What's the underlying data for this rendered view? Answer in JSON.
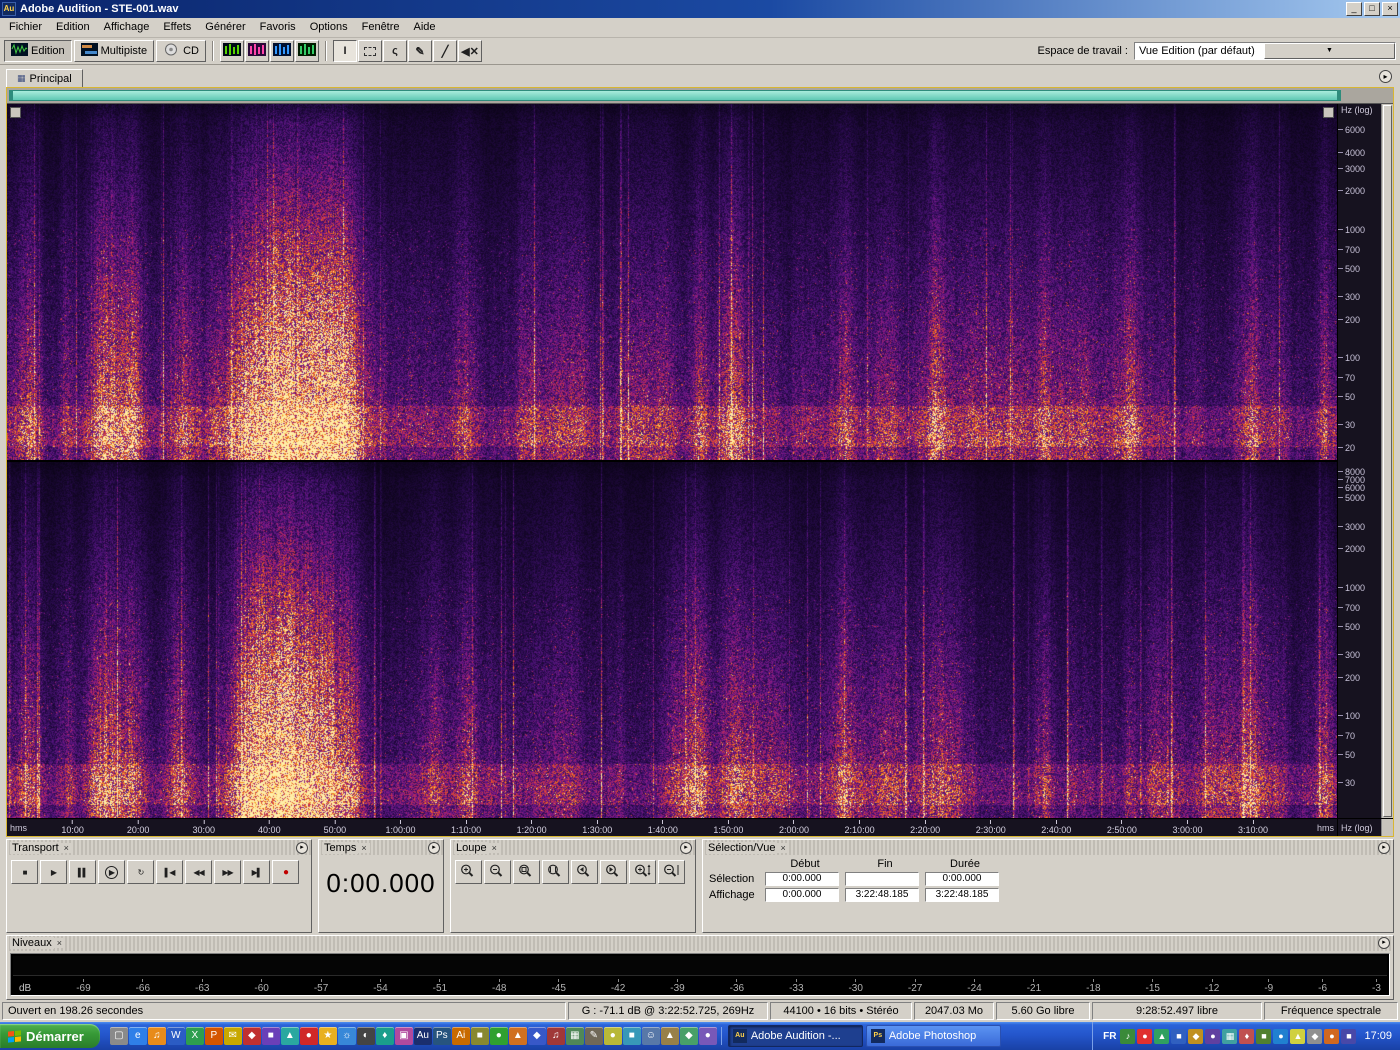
{
  "window": {
    "title": "Adobe Audition - STE-001.wav",
    "icon_text": "Au"
  },
  "icons": {
    "minimize": "_",
    "maximize": "□",
    "close": "×",
    "combo_arrow": "▼",
    "close_panel": "×",
    "panel_menu": "▸",
    "tab_icon": "▦"
  },
  "menubar": {
    "items": [
      "Fichier",
      "Edition",
      "Affichage",
      "Effets",
      "Générer",
      "Favoris",
      "Options",
      "Fenêtre",
      "Aide"
    ]
  },
  "toolbar": {
    "modes": [
      {
        "label": "Edition",
        "active": true,
        "icon": "waveform"
      },
      {
        "label": "Multipiste",
        "active": false,
        "icon": "multitrack"
      },
      {
        "label": "CD",
        "active": false,
        "icon": "cd"
      }
    ],
    "view_buttons": [
      {
        "name": "waveform-view-icon",
        "bg": "#000814",
        "fg": "#55d400"
      },
      {
        "name": "spectral-view-icon",
        "bg": "#2a0838",
        "fg": "#ff44aa"
      },
      {
        "name": "spectral-pan-view-icon",
        "bg": "#001030",
        "fg": "#3399ff"
      },
      {
        "name": "spectral-phase-view-icon",
        "bg": "#001c00",
        "fg": "#33cc66"
      }
    ],
    "tools": [
      {
        "name": "time-selection-tool",
        "glyph": "I",
        "active": true
      },
      {
        "name": "marquee-selection-tool",
        "glyph": "",
        "active": false
      },
      {
        "name": "lasso-selection-tool",
        "glyph": "ς",
        "active": false
      },
      {
        "name": "effects-paintbrush-tool",
        "glyph": "✎",
        "active": false
      },
      {
        "name": "pencil-tool",
        "glyph": "╱",
        "active": false
      },
      {
        "name": "scrub-tool",
        "glyph": "◀✕",
        "active": false
      }
    ],
    "workspace_label": "Espace de travail :",
    "workspace_value": "Vue Edition (par défaut)"
  },
  "main_panel": {
    "tab_label": "Principal",
    "hz_log_label": "Hz (log)",
    "hms_label": "hms",
    "freq_ticks_top": [
      "6000",
      "4000",
      "3000",
      "2000",
      "1000",
      "700",
      "500",
      "300",
      "200",
      "100",
      "70",
      "50",
      "30",
      "20"
    ],
    "freq_ticks_bottom": [
      "8000",
      "7000",
      "6000",
      "5000",
      "3000",
      "2000",
      "1000",
      "700",
      "500",
      "300",
      "200",
      "100",
      "70",
      "50",
      "30"
    ],
    "timeline_labels": [
      "10:00",
      "20:00",
      "30:00",
      "40:00",
      "50:00",
      "1:00:00",
      "1:10:00",
      "1:20:00",
      "1:30:00",
      "1:40:00",
      "1:50:00",
      "2:00:00",
      "2:10:00",
      "2:20:00",
      "2:30:00",
      "2:40:00",
      "2:50:00",
      "3:00:00",
      "3:10:00"
    ],
    "duration_min": 202.8,
    "colors": {
      "overview_bar": "#6fd0c0",
      "focus_border": "#d8b632"
    }
  },
  "transport": {
    "title": "Transport",
    "buttons": [
      {
        "name": "stop-button",
        "glyph": "■"
      },
      {
        "name": "play-button",
        "glyph": "▶"
      },
      {
        "name": "pause-button",
        "glyph": "▌▌"
      },
      {
        "name": "play-from-cursor-button",
        "glyph": "▶",
        "circle": true
      },
      {
        "name": "play-looped-button",
        "glyph": "↻"
      },
      {
        "name": "go-to-beginning-button",
        "glyph": "▌◀"
      },
      {
        "name": "rewind-button",
        "glyph": "◀◀"
      },
      {
        "name": "fast-forward-button",
        "glyph": "▶▶"
      },
      {
        "name": "go-to-end-button",
        "glyph": "▶▌"
      },
      {
        "name": "record-button",
        "glyph": "●",
        "red": true
      }
    ]
  },
  "temps": {
    "title": "Temps",
    "value": "0:00.000"
  },
  "loupe": {
    "title": "Loupe",
    "buttons": [
      {
        "name": "zoom-in-horizontal-button",
        "deco": "plus"
      },
      {
        "name": "zoom-out-horizontal-button",
        "deco": "minus"
      },
      {
        "name": "zoom-full-button",
        "deco": "full"
      },
      {
        "name": "zoom-to-selection-button",
        "deco": "sel"
      },
      {
        "name": "zoom-left-edge-selection-button",
        "deco": "left"
      },
      {
        "name": "zoom-right-edge-selection-button",
        "deco": "right"
      },
      {
        "name": "zoom-in-vertical-button",
        "deco": "vplus"
      },
      {
        "name": "zoom-out-vertical-button",
        "deco": "vminus"
      }
    ]
  },
  "selection_vue": {
    "title": "Sélection/Vue",
    "columns": [
      "Début",
      "Fin",
      "Durée"
    ],
    "rows": [
      {
        "label": "Sélection",
        "values": [
          "0:00.000",
          "",
          "0:00.000"
        ]
      },
      {
        "label": "Affichage",
        "values": [
          "0:00.000",
          "3:22:48.185",
          "3:22:48.185"
        ]
      }
    ]
  },
  "niveaux": {
    "title": "Niveaux",
    "db_label": "dB",
    "scale": [
      "-69",
      "-66",
      "-63",
      "-60",
      "-57",
      "-54",
      "-51",
      "-48",
      "-45",
      "-42",
      "-39",
      "-36",
      "-33",
      "-30",
      "-27",
      "-24",
      "-21",
      "-18",
      "-15",
      "-12",
      "-9",
      "-6",
      "-3"
    ]
  },
  "statusbar": {
    "sections": [
      "Ouvert en 198.26 secondes",
      "G : -71.1 dB @ 3:22:52.725, 269Hz",
      "44100 • 16 bits • Stéréo",
      "2047.03 Mo",
      "5.60 Go libre",
      "9:28:52.497 libre",
      "Fréquence spectrale"
    ]
  },
  "taskbar": {
    "start_label": "Démarrer",
    "quicklaunch": [
      {
        "g": "▢",
        "c": "#8a8a8a"
      },
      {
        "g": "e",
        "c": "#2f7fe8"
      },
      {
        "g": "♫",
        "c": "#e88b1a"
      },
      {
        "g": "W",
        "c": "#2b5cc4"
      },
      {
        "g": "X",
        "c": "#2e9e4f"
      },
      {
        "g": "P",
        "c": "#d45500"
      },
      {
        "g": "✉",
        "c": "#c8a800"
      },
      {
        "g": "◆",
        "c": "#c03030"
      },
      {
        "g": "■",
        "c": "#6a3fb8"
      },
      {
        "g": "▲",
        "c": "#2aa8a0"
      },
      {
        "g": "●",
        "c": "#d02828"
      },
      {
        "g": "★",
        "c": "#e8b020"
      },
      {
        "g": "☼",
        "c": "#3888d8"
      },
      {
        "g": "◐",
        "c": "#444444"
      },
      {
        "g": "♦",
        "c": "#1a9e8c"
      },
      {
        "g": "▣",
        "c": "#b04a9e"
      },
      {
        "g": "Au",
        "c": "#1a2e6e"
      },
      {
        "g": "Ps",
        "c": "#27547e"
      },
      {
        "g": "Ai",
        "c": "#c86a00"
      },
      {
        "g": "■",
        "c": "#888830"
      },
      {
        "g": "●",
        "c": "#30a030"
      },
      {
        "g": "▲",
        "c": "#d07020"
      },
      {
        "g": "◆",
        "c": "#3858c8"
      },
      {
        "g": "♫",
        "c": "#a03838"
      },
      {
        "g": "▦",
        "c": "#508858"
      },
      {
        "g": "✎",
        "c": "#706858"
      },
      {
        "g": "●",
        "c": "#b8b838"
      },
      {
        "g": "■",
        "c": "#3898b8"
      },
      {
        "g": "☺",
        "c": "#5878a8"
      },
      {
        "g": "▲",
        "c": "#988048"
      },
      {
        "g": "◆",
        "c": "#48a068"
      },
      {
        "g": "●",
        "c": "#7858b8"
      }
    ],
    "tasks": [
      {
        "label": "Adobe Audition -...",
        "icon": "Au",
        "active": true
      },
      {
        "label": "Adobe Photoshop",
        "icon": "Ps",
        "active": false
      }
    ],
    "tray": [
      {
        "g": "FR",
        "c": ""
      },
      {
        "g": "♪",
        "c": "#3a8a3a"
      },
      {
        "g": "●",
        "c": "#e03030"
      },
      {
        "g": "▲",
        "c": "#30a060"
      },
      {
        "g": "■",
        "c": "#3060c0"
      },
      {
        "g": "◆",
        "c": "#c09020"
      },
      {
        "g": "●",
        "c": "#6040a0"
      },
      {
        "g": "▦",
        "c": "#40a0a0"
      },
      {
        "g": "♦",
        "c": "#c05050"
      },
      {
        "g": "■",
        "c": "#508030"
      },
      {
        "g": "●",
        "c": "#2080d0"
      },
      {
        "g": "▲",
        "c": "#d0d040"
      },
      {
        "g": "◆",
        "c": "#909090"
      },
      {
        "g": "●",
        "c": "#d06820"
      },
      {
        "g": "■",
        "c": "#4848a8"
      }
    ],
    "clock": "17:09"
  }
}
